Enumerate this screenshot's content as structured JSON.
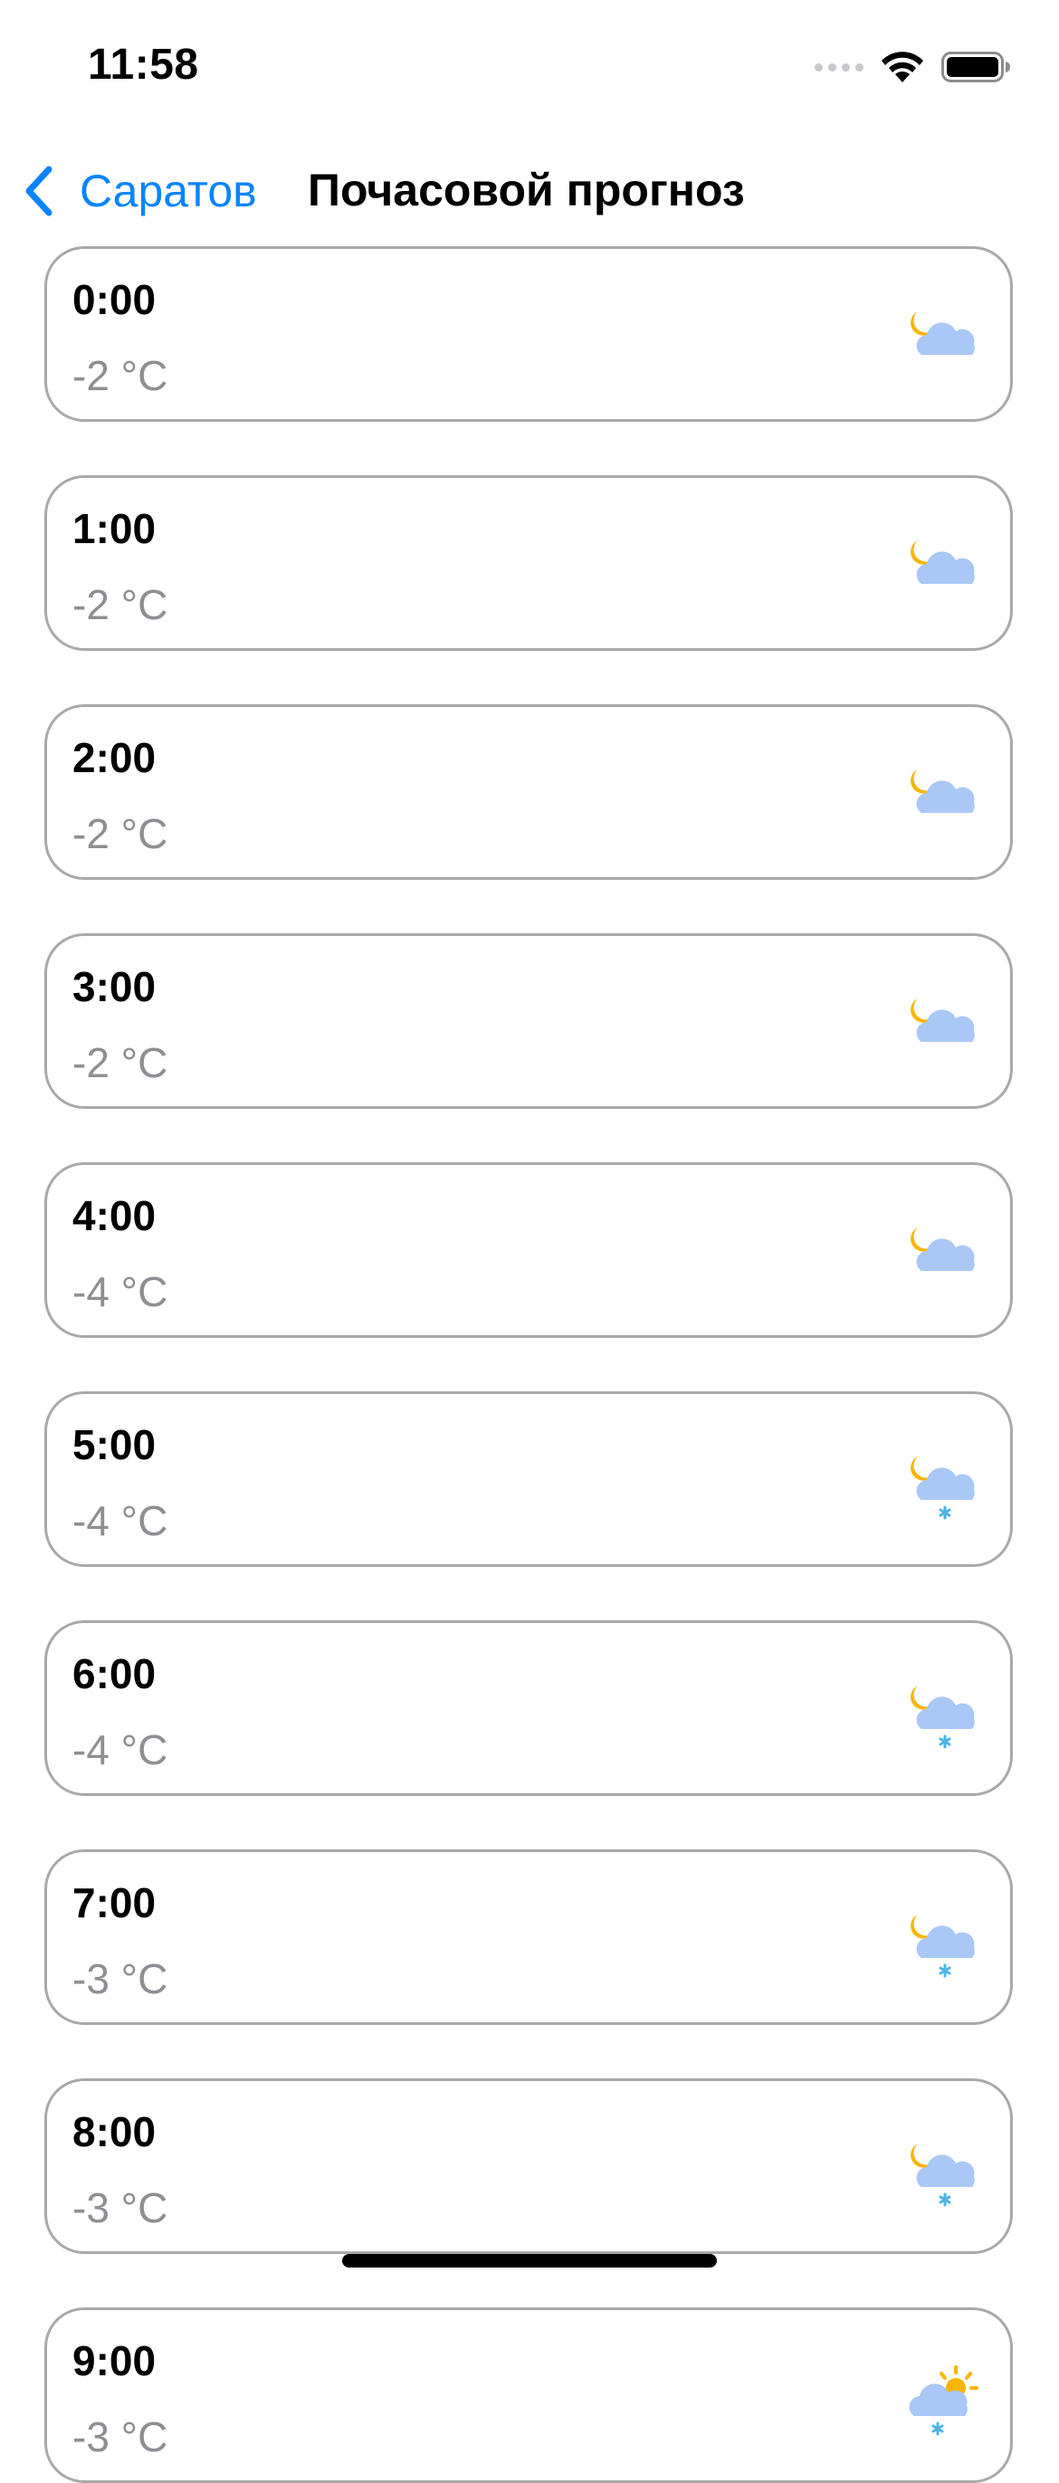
{
  "status_bar": {
    "time": "11:58",
    "icons": [
      "signal-dots-icon",
      "wifi-icon",
      "battery-icon"
    ]
  },
  "nav": {
    "back_label": "Саратов",
    "title": "Почасовой прогноз",
    "accent_color": "#0a84ff"
  },
  "forecast": [
    {
      "time": "0:00",
      "temp": "-2 °C",
      "icon": "moon-cloud-icon"
    },
    {
      "time": "1:00",
      "temp": "-2 °C",
      "icon": "moon-cloud-icon"
    },
    {
      "time": "2:00",
      "temp": "-2 °C",
      "icon": "moon-cloud-icon"
    },
    {
      "time": "3:00",
      "temp": "-2 °C",
      "icon": "moon-cloud-icon"
    },
    {
      "time": "4:00",
      "temp": "-4 °C",
      "icon": "moon-cloud-icon"
    },
    {
      "time": "5:00",
      "temp": "-4 °C",
      "icon": "moon-cloud-snow-icon"
    },
    {
      "time": "6:00",
      "temp": "-4 °C",
      "icon": "moon-cloud-snow-icon"
    },
    {
      "time": "7:00",
      "temp": "-3 °C",
      "icon": "moon-cloud-snow-icon"
    },
    {
      "time": "8:00",
      "temp": "-3 °C",
      "icon": "moon-cloud-snow-icon"
    },
    {
      "time": "9:00",
      "temp": "-3 °C",
      "icon": "sun-cloud-snow-icon"
    }
  ]
}
